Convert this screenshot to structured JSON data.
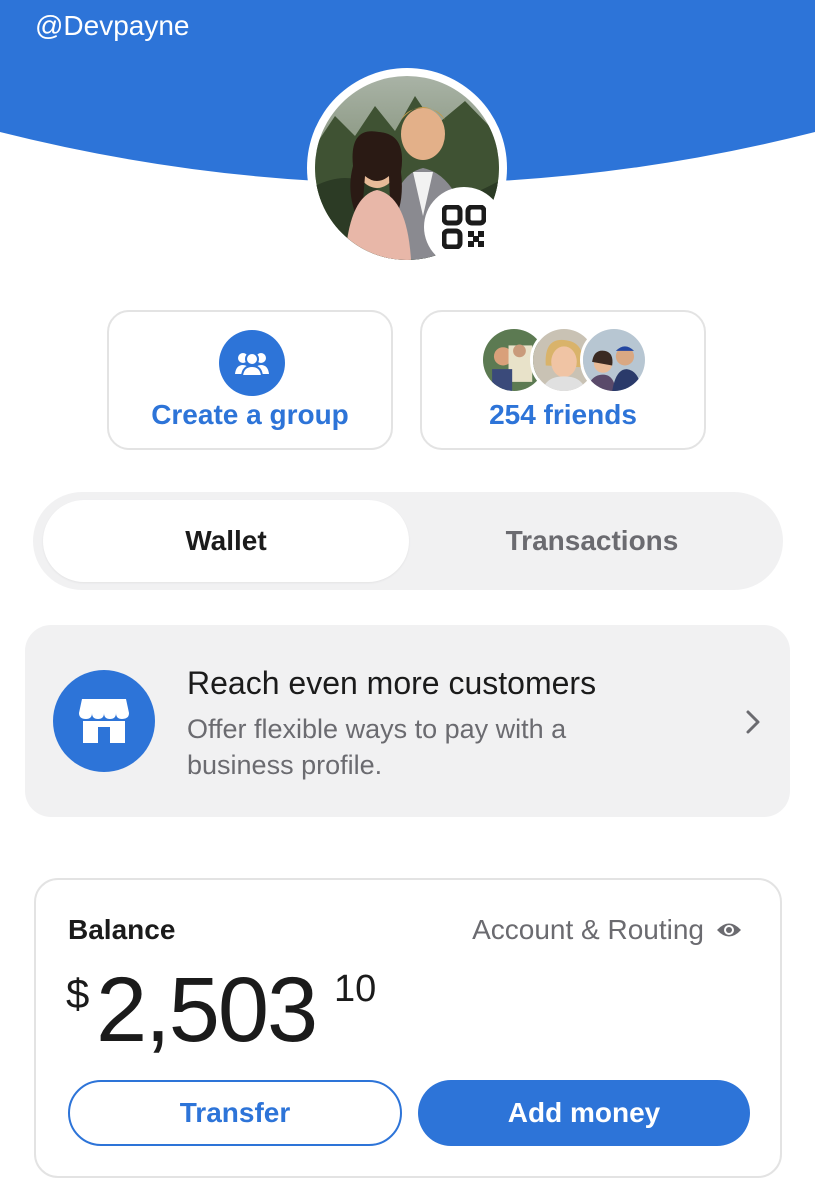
{
  "header": {
    "username": "@Devpayne",
    "bg_color": "#2d74d8"
  },
  "profile": {
    "avatar_icon": "profile-photo",
    "qr_icon": "qr-code-icon"
  },
  "actions": {
    "create_group": {
      "label": "Create a group",
      "icon": "group-icon"
    },
    "friends": {
      "label": "254 friends",
      "icon": "friend-avatars"
    }
  },
  "tabs": {
    "wallet": "Wallet",
    "transactions": "Transactions",
    "active": "Wallet"
  },
  "promo": {
    "title": "Reach even more customers",
    "subtitle": "Offer flexible ways to pay with a business profile.",
    "icon": "storefront-icon"
  },
  "balance": {
    "label": "Balance",
    "account_link": "Account & Routing",
    "currency": "$",
    "whole": "2,503",
    "cents": "10",
    "transfer_label": "Transfer",
    "add_money_label": "Add money"
  },
  "colors": {
    "accent": "#2d74d8",
    "muted_bg": "#f1f1f2",
    "muted_text": "#6b6b70"
  }
}
